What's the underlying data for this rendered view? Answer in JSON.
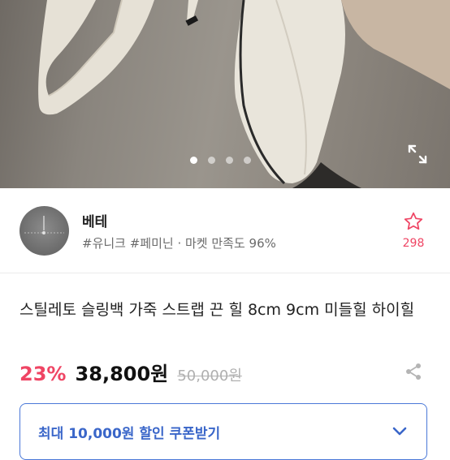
{
  "gallery": {
    "total": 4,
    "active_index": 0,
    "icon": "expand-icon"
  },
  "seller": {
    "name": "베테",
    "tags": "#유니크 #페미닌 · 마켓 만족도 96%",
    "favorite_count": "298",
    "favorite_icon": "star-outline-icon"
  },
  "product": {
    "title": "스틸레토 슬링백 가죽 스트랩 끈 힐 8cm 9cm 미들힐 하이힐",
    "discount": "23%",
    "price": "38,800원",
    "original_price": "50,000원",
    "share_icon": "share-icon"
  },
  "coupon": {
    "label": "최대 10,000원 할인 쿠폰받기",
    "icon": "chevron-down-icon"
  },
  "colors": {
    "accent_pink": "#ef4564",
    "coupon_blue": "#3a66c9",
    "coupon_border": "#4a78d8"
  }
}
